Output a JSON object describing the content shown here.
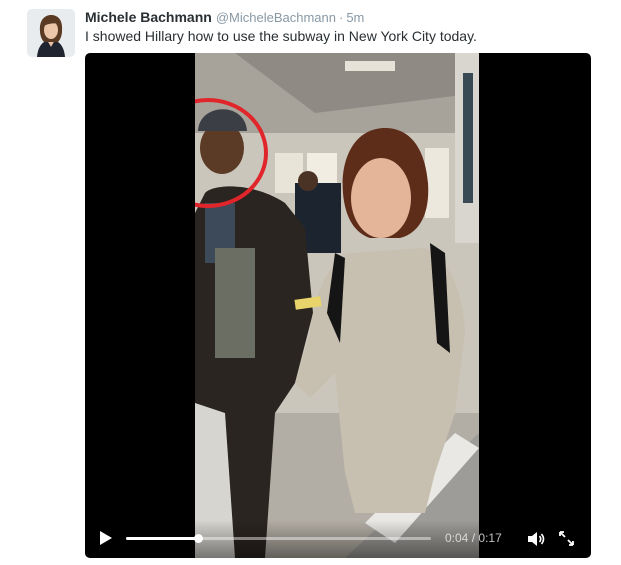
{
  "tweet": {
    "author_name": "Michele Bachmann",
    "author_handle": "@MicheleBachmann",
    "separator": "·",
    "timestamp": "5m",
    "text": "I showed Hillary how to use the subway in New York City today."
  },
  "video": {
    "current_time": "0:04",
    "time_divider": "/",
    "duration": "0:17",
    "progress": 0.235,
    "icons": {
      "play": "play-icon",
      "volume": "volume-icon",
      "fullscreen": "fullscreen-icon"
    }
  },
  "colors": {
    "name": "#292f33",
    "handle": "#8899a6",
    "annotation_circle": "#e0262b",
    "video_bg": "#000000"
  }
}
